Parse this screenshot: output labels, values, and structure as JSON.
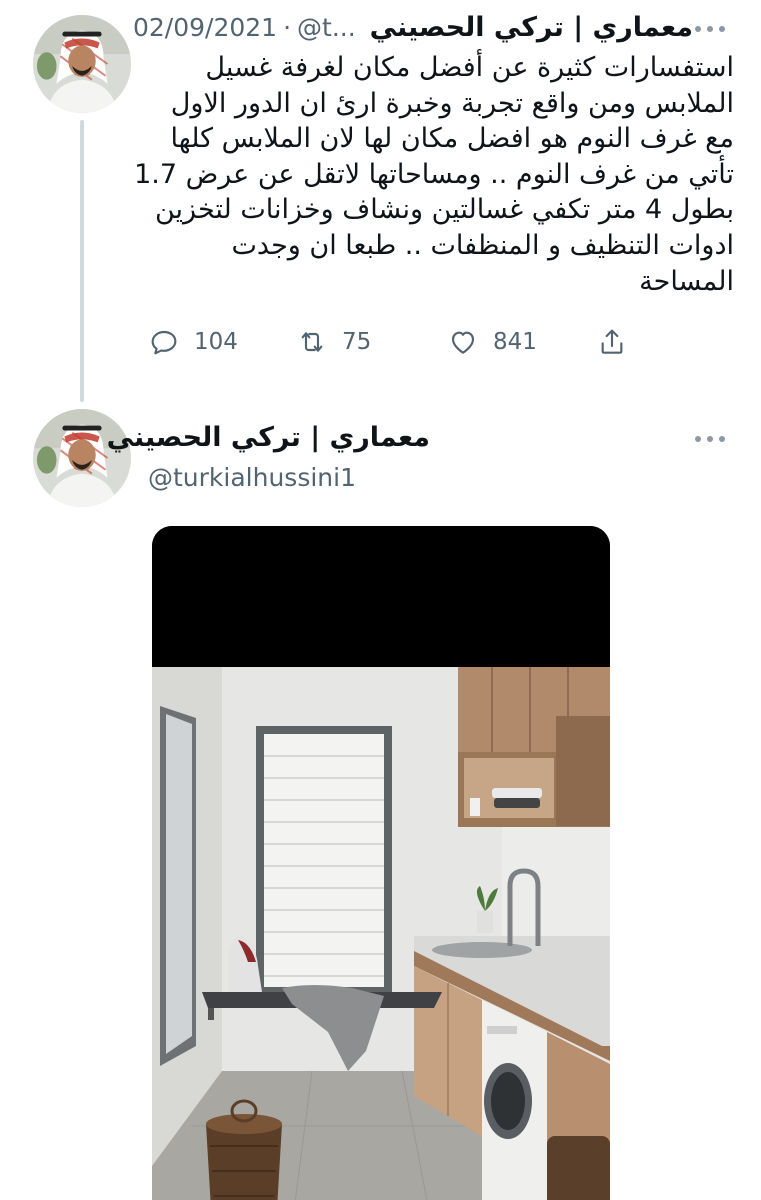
{
  "tweet1": {
    "display_name": "معماري | تركي الحصيني",
    "handle_truncated": "@t...",
    "date": "02/09/2021",
    "body_lines": [
      "استفسارات كثيرة عن أفضل مكان لغرفة غسيل",
      "الملابس  ومن واقع تجربة وخبرة ارئ ان الدور الاول",
      "مع غرف النوم هو افضل مكان لها لان الملابس كلها",
      "تأتي من غرف النوم ..  ومساحاتها لاتقل عن عرض 1.7",
      "بطول 4 متر تكفي غسالتين ونشاف وخزانات لتخزين",
      "ادوات التنظيف و المنظفات ..  طبعا ان وجدت",
      "المساحة"
    ],
    "actions": {
      "replies": "104",
      "retweets": "75",
      "likes": "841"
    }
  },
  "tweet2": {
    "display_name": "معماري | تركي الحصيني",
    "handle": "@turkialhussini1"
  },
  "icons": {
    "reply": "reply-icon",
    "retweet": "retweet-icon",
    "like": "heart-icon",
    "share": "share-icon",
    "more": "more-dots-icon"
  },
  "colors": {
    "text_primary": "#0f1419",
    "text_secondary": "#536471",
    "thread_line": "#cfd9de"
  }
}
